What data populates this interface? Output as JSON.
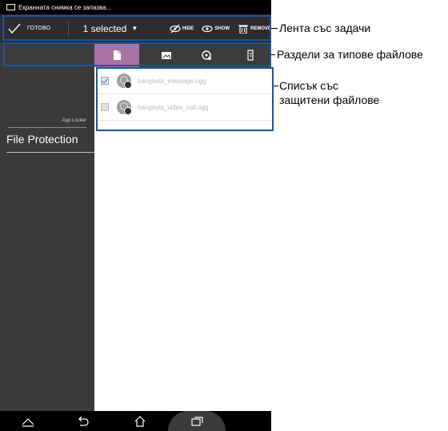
{
  "status_bar": {
    "notification": "Екранната снимка се запазва..."
  },
  "action_bar": {
    "done_label": "ГОТОВО",
    "selection_label": "1 selected",
    "hide_label": "HIDE",
    "show_label": "SHOW",
    "remove_label": "REMOVE"
  },
  "tabs": [
    {
      "icon": "document-icon",
      "active": true
    },
    {
      "icon": "image-icon",
      "active": false
    },
    {
      "icon": "music-icon",
      "active": false
    },
    {
      "icon": "file-icon",
      "active": false
    }
  ],
  "sidebar": {
    "section_label": "App Locker",
    "current_item": "File Protection"
  },
  "files": [
    {
      "name": "hangouts_message.ogg",
      "checked": true
    },
    {
      "name": "hangouts_video_call.ogg",
      "checked": false
    }
  ],
  "nav_bar": {
    "buttons": [
      "back-icon",
      "home-icon",
      "recent-apps-icon"
    ]
  },
  "annotations": {
    "taskbar": "Лента със задачи",
    "file_type_tabs": "Раздели за типове файлове",
    "protected_list_line1": "Списък със",
    "protected_list_line2": "защитени файлове"
  },
  "colors": {
    "accent_tab": "#a974a4",
    "callout_border": "#1d5598",
    "action_bar": "#2d2d2d"
  }
}
